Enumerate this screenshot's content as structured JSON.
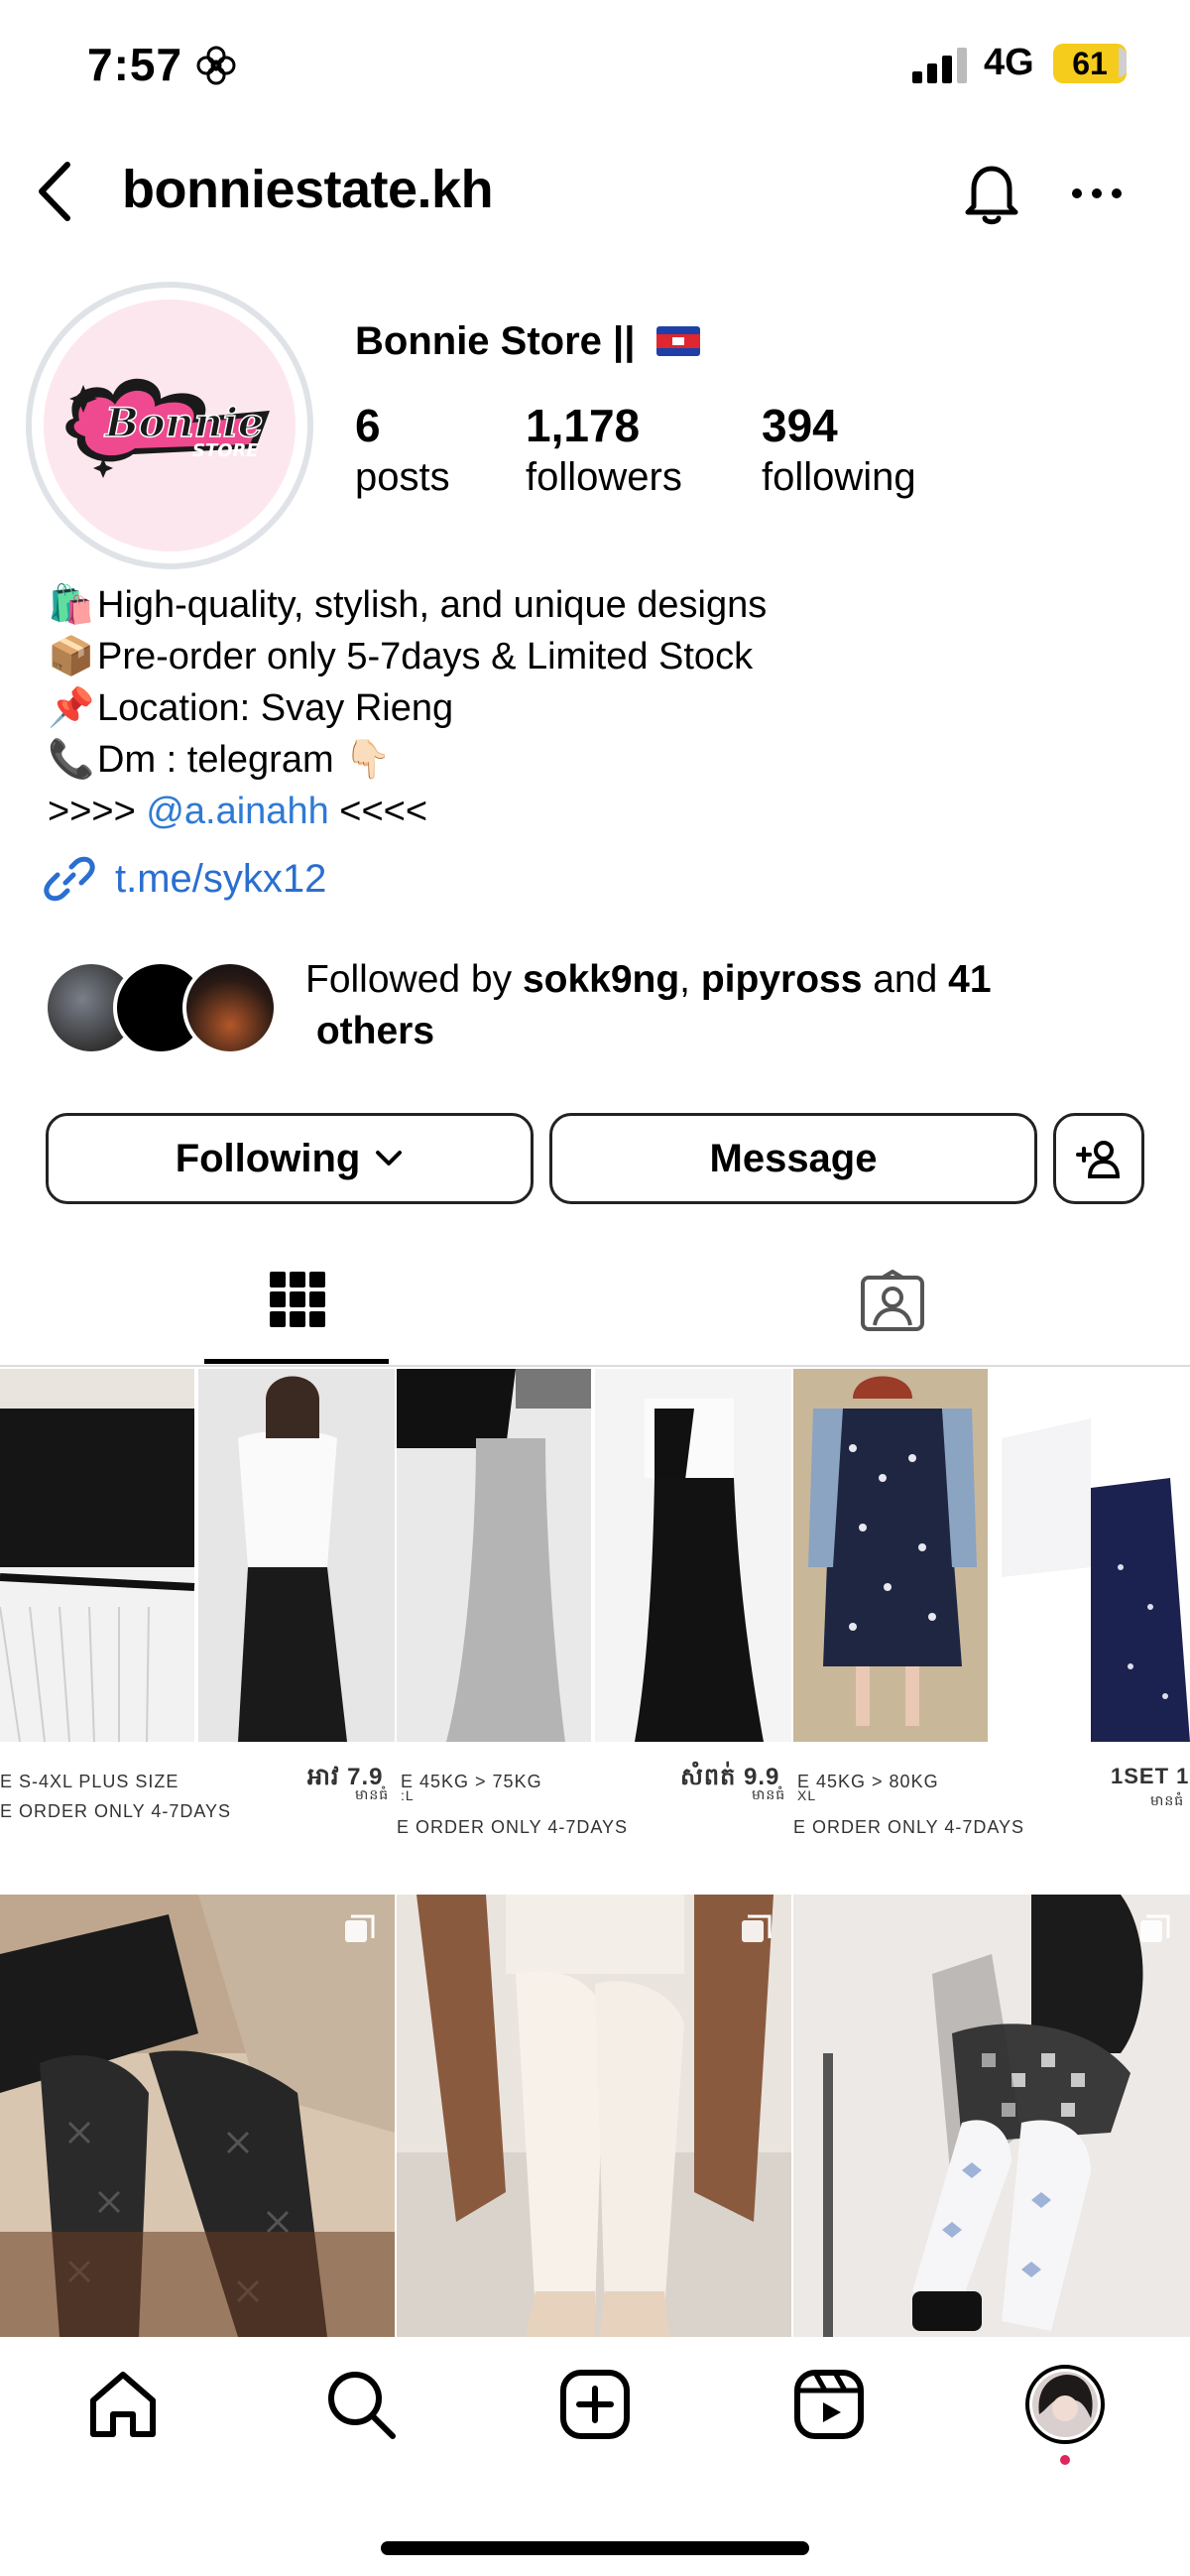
{
  "status_bar": {
    "time": "7:57",
    "network": "4G",
    "battery": "61"
  },
  "header": {
    "username": "bonniestate.kh"
  },
  "profile": {
    "display_name": "Bonnie Store ||",
    "logo_text": "Bonnie",
    "logo_sub": "STORE",
    "posts": {
      "count": "6",
      "label": "posts"
    },
    "followers": {
      "count": "1,178",
      "label": "followers"
    },
    "following": {
      "count": "394",
      "label": "following"
    }
  },
  "bio": {
    "line1": {
      "emoji": "🛍️",
      "text": "High-quality, stylish, and unique designs"
    },
    "line2": {
      "emoji": "📦",
      "text": "Pre-order only 5-7days & Limited Stock"
    },
    "line3": {
      "emoji": "📌",
      "text": "Location: Svay Rieng"
    },
    "line4": {
      "emoji": "📞",
      "text": "Dm : telegram 👇🏻"
    },
    "line5": {
      "prefix": ">>>> ",
      "mention": "@a.ainahh",
      "suffix": " <<<<"
    },
    "link": "t.me/sykx12"
  },
  "followed_by": {
    "prefix": "Followed by ",
    "user1": "sokk9ng",
    "sep": ", ",
    "user2": "pipyross",
    "mid": " and ",
    "count": "41",
    "suffix": " others"
  },
  "actions": {
    "following": "Following",
    "message": "Message"
  },
  "grid": {
    "captions": [
      "E S-4XL PLUS SIZE",
      "E ORDER ONLY 4-7DAYS",
      "អាវ 7.9",
      "មានធំ",
      "E 45KG > 75KG",
      "E ORDER ONLY 4-7DAYS",
      "សំពត់ 9.9",
      "មានធំ",
      "E 45KG > 80KG",
      "E ORDER ONLY 4-7DAYS",
      "1SET 1",
      "មានធំ",
      ":L",
      "XL"
    ]
  },
  "colors": {
    "link": "#2f7ad4",
    "battery": "#f5cc1b",
    "notification_dot": "#e0245e"
  }
}
